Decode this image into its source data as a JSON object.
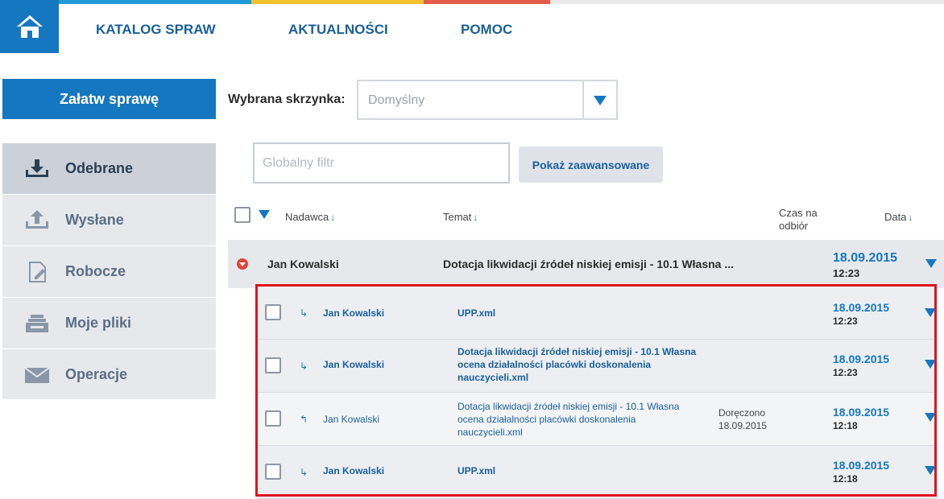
{
  "nav": {
    "home_icon": "home-icon",
    "items": [
      "KATALOG SPRAW",
      "AKTUALNOŚCI",
      "POMOC"
    ],
    "stripe_colors": [
      "#1f9ad6",
      "#f2c12e",
      "#e35b4b",
      "#eaeaea"
    ]
  },
  "sidebar": {
    "primary_button": "Załatw sprawę",
    "items": [
      {
        "label": "Odebrane",
        "icon": "inbox-download-icon"
      },
      {
        "label": "Wysłane",
        "icon": "outbox-upload-icon"
      },
      {
        "label": "Robocze",
        "icon": "draft-edit-icon"
      },
      {
        "label": "Moje pliki",
        "icon": "file-tray-icon"
      },
      {
        "label": "Operacje",
        "icon": "envelope-icon"
      }
    ]
  },
  "mailbox": {
    "label": "Wybrana skrzynka:",
    "selected": "Domyślny"
  },
  "filter": {
    "placeholder": "Globalny filtr",
    "advanced_button": "Pokaż zaawansowane"
  },
  "table": {
    "headers": {
      "sender": "Nadawca",
      "subject": "Temat",
      "pickup_time_line1": "Czas na",
      "pickup_time_line2": "odbiór",
      "date": "Data",
      "sort_arrow": "↓"
    },
    "group": {
      "sender": "Jan Kowalski",
      "subject": "Dotacja likwidacji źródeł niskiej emisji - 10.1 Własna ...",
      "date": "18.09.2015",
      "time": "12:23"
    },
    "messages": [
      {
        "sender": "Jan Kowalski",
        "subject": [
          "UPP.xml"
        ],
        "status": [
          "",
          ""
        ],
        "date": "18.09.2015",
        "time": "12:23",
        "reply_glyph": "↳"
      },
      {
        "sender": "Jan Kowalski",
        "subject": [
          "Dotacja likwidacji źródeł niskiej emisji - 10.1 Własna",
          "ocena działalności placówki doskonalenia",
          "nauczycieli.xml"
        ],
        "status": [
          "",
          ""
        ],
        "date": "18.09.2015",
        "time": "12:23",
        "reply_glyph": "↳"
      },
      {
        "sender": "Jan Kowalski",
        "subject": [
          "Dotacja likwidacji źródeł niskiej emisji - 10.1 Własna",
          "ocena działalności placówki doskonalenia",
          "nauczycieli.xml"
        ],
        "status": [
          "Doręczono",
          "18.09.2015"
        ],
        "date": "18.09.2015",
        "time": "12:18",
        "reply_glyph": "↰"
      },
      {
        "sender": "Jan Kowalski",
        "subject": [
          "UPP.xml"
        ],
        "status": [
          "",
          ""
        ],
        "date": "18.09.2015",
        "time": "12:18",
        "reply_glyph": "↳"
      }
    ]
  },
  "colors": {
    "accent": "#1577c0",
    "highlight": "#e0141e"
  }
}
